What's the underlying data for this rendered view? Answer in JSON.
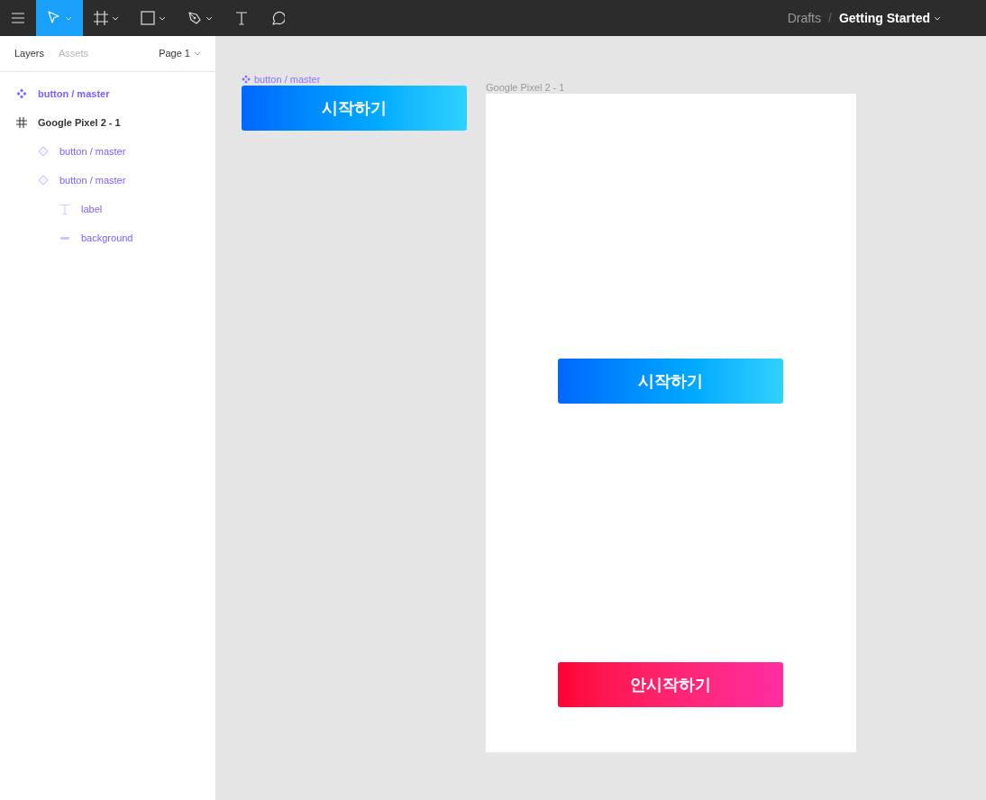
{
  "toolbar": {
    "tools": [
      {
        "kind": "move",
        "selected": true,
        "dropdown": true
      },
      {
        "kind": "frame",
        "selected": false,
        "dropdown": true
      },
      {
        "kind": "rectangle",
        "selected": false,
        "dropdown": true
      },
      {
        "kind": "pen",
        "selected": false,
        "dropdown": true
      },
      {
        "kind": "text",
        "selected": false,
        "dropdown": false
      },
      {
        "kind": "comment",
        "selected": false,
        "dropdown": false
      }
    ],
    "breadcrumb": {
      "folder": "Drafts",
      "separator": "/",
      "file": "Getting Started"
    }
  },
  "sidebar": {
    "tabs": [
      {
        "label": "Layers",
        "selected": true
      },
      {
        "label": "Assets",
        "selected": false
      }
    ],
    "page": "Page 1",
    "layers": [
      {
        "kind": "component",
        "name": "button / master"
      },
      {
        "kind": "frame",
        "name": "Google Pixel 2 - 1",
        "children": [
          {
            "kind": "instance",
            "name": "button / master"
          },
          {
            "kind": "instance",
            "name": "button / master",
            "children": [
              {
                "kind": "text",
                "name": "label"
              },
              {
                "kind": "rectangle",
                "name": "background"
              }
            ]
          }
        ]
      }
    ]
  },
  "canvas": {
    "component": {
      "name": "button / master",
      "button": {
        "kind": "primary",
        "label": "시작하기"
      }
    },
    "frame": {
      "name": "Google Pixel 2 - 1",
      "buttons": [
        {
          "kind": "primary",
          "label": "시작하기"
        },
        {
          "kind": "danger",
          "label": "안시작하기"
        }
      ]
    }
  }
}
